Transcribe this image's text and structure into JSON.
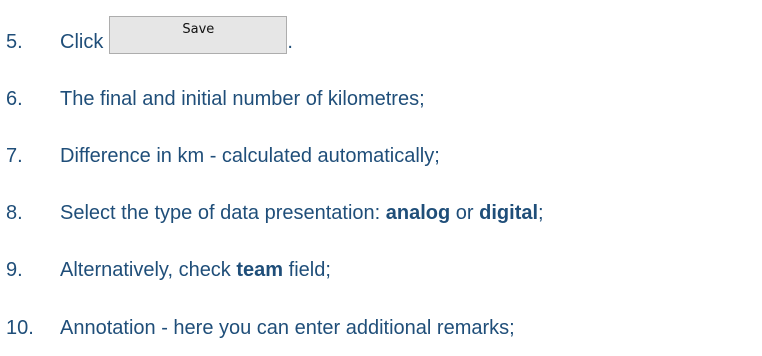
{
  "steps": [
    {
      "number": "5.",
      "text": "Click",
      "button_label": "Save",
      "suffix": "."
    },
    {
      "number": "6.",
      "text": "The final and initial number of kilometres;"
    },
    {
      "number": "7.",
      "text": "Difference in km - calculated automatically;"
    },
    {
      "number": "8.",
      "text_before": "Select the type of data presentation: ",
      "bold_1": "analog",
      "text_middle": " or ",
      "bold_2": "digital",
      "suffix": ";"
    },
    {
      "number": "9.",
      "text_before": "Alternatively, check ",
      "bold": "team",
      "text_after": " field;"
    },
    {
      "number": "10.",
      "text": "Annotation - here you can enter additional remarks;"
    }
  ],
  "colors": {
    "text": "#1f4e79",
    "button_background": "#e6e6e6",
    "button_border": "#adadad"
  }
}
